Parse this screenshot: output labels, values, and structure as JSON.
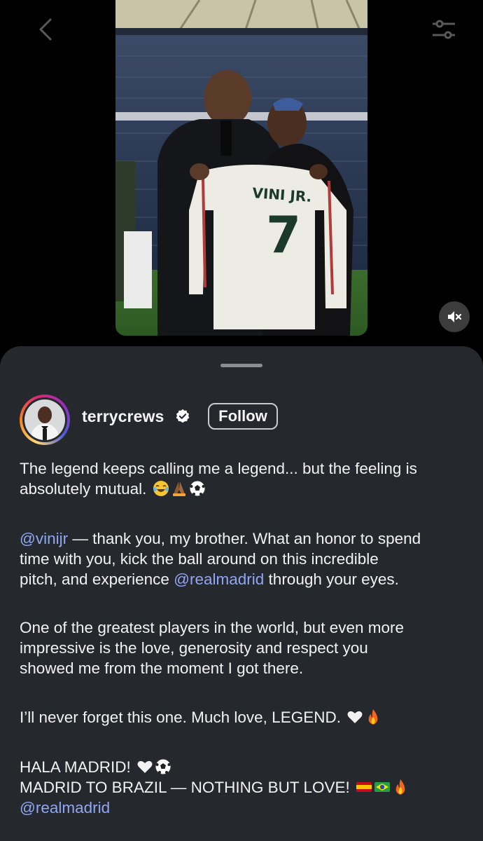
{
  "post": {
    "username": "terrycrews",
    "follow_label": "Follow",
    "verified": true
  },
  "media": {
    "jersey_name": "VINI JR.",
    "jersey_number": "7"
  },
  "caption": {
    "p1_line1": "The legend keeps calling me a legend... but the feeling is",
    "p1_line2": "absolutely mutual.",
    "p2_mention1": "@vinijr",
    "p2_line1_rest": " — thank you, my brother. What an honor to spend",
    "p2_line2": "time with you, kick the ball around on this incredible",
    "p2_line3_pre": "pitch, and experience ",
    "p2_mention2": "@realmadrid",
    "p2_line3_post": " through your eyes.",
    "p3_line1": "One of the greatest players in the world, but even more",
    "p3_line2": "impressive is the love, generosity and respect you",
    "p3_line3": "showed me from the moment I got there.",
    "p4_line1": "I’ll never forget this one. Much love, LEGEND.",
    "p5_line1": "HALA MADRID!",
    "p5_line2": "MADRID TO BRAZIL — NOTHING BUT LOVE!",
    "p5_mention": "@realmadrid"
  },
  "icons": {
    "back": "chevron-left-icon",
    "filter": "sliders-icon",
    "mute": "speaker-muted-icon",
    "verified": "verified-badge-icon"
  },
  "colors": {
    "sheet_bg": "#25282d",
    "mention": "#8fa7f5",
    "verified_badge": "#ffffff"
  }
}
